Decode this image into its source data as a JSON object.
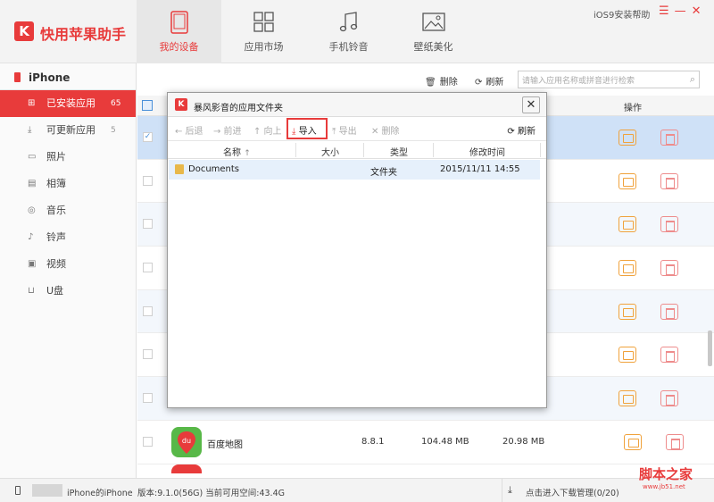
{
  "app": {
    "title": "快用苹果助手",
    "logo_letter": "K",
    "help": "iOS9安装帮助"
  },
  "nav": [
    {
      "label": "我的设备",
      "icon": "tablet-icon",
      "active": true
    },
    {
      "label": "应用市场",
      "icon": "grid-icon"
    },
    {
      "label": "手机铃音",
      "icon": "music-note-icon"
    },
    {
      "label": "壁纸美化",
      "icon": "picture-icon"
    }
  ],
  "sidebar": {
    "device": "iPhone",
    "items": [
      {
        "label": "已安装应用",
        "count": "65",
        "icon": "apps-grid-icon",
        "active": true
      },
      {
        "label": "可更新应用",
        "count": "5",
        "icon": "download-icon"
      },
      {
        "label": "照片",
        "count": "",
        "icon": "photo-icon"
      },
      {
        "label": "相簿",
        "count": "",
        "icon": "album-icon"
      },
      {
        "label": "音乐",
        "count": "",
        "icon": "music-disc-icon"
      },
      {
        "label": "铃声",
        "count": "",
        "icon": "ringtone-icon"
      },
      {
        "label": "视频",
        "count": "",
        "icon": "video-icon"
      },
      {
        "label": "U盘",
        "count": "",
        "icon": "usb-drive-icon"
      }
    ]
  },
  "toolbar": {
    "delete": "删除",
    "refresh": "刷新",
    "search_placeholder": "请输入应用名称或拼音进行检索"
  },
  "table": {
    "header_op": "操作",
    "visible_app": {
      "name": "百度地图",
      "icon_text": "du",
      "version": "8.8.1",
      "size": "104.48 MB",
      "doc_size": "20.98 MB"
    }
  },
  "dialog": {
    "title": "暴风影音的应用文件夹",
    "tools": {
      "back": "← 后退",
      "forward": "→ 前进",
      "up": "↑ 向上",
      "import": "导入",
      "export": "导出",
      "delete": "✕ 删除",
      "refresh": "刷新"
    },
    "columns": {
      "name": "名称",
      "sort": "↑",
      "size": "大小",
      "type": "类型",
      "modified": "修改时间"
    },
    "rows": [
      {
        "name": "Documents",
        "type": "文件夹",
        "modified": "2015/11/11 14:55"
      }
    ]
  },
  "status": {
    "device_name": "iPhone的iPhone",
    "version_info": "版本:9.1.0(56G) 当前可用空间:43.4G",
    "download": "点击进入下载管理(0/20)"
  },
  "watermark": {
    "main": "脚本之家",
    "sub": "www.jb51.net"
  },
  "colors": {
    "accent": "#e83b3b",
    "folder_button": "#f0a23c",
    "selected_row": "#cfe1f7"
  }
}
